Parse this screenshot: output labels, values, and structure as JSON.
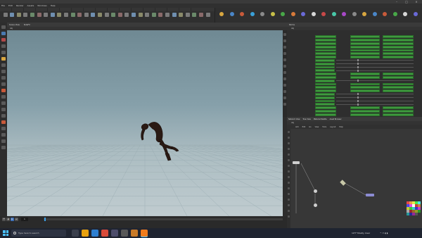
{
  "titlebar": {
    "text": ""
  },
  "menubar": {
    "items": [
      "File",
      "Edit",
      "Render",
      "Assets",
      "Windows",
      "Help"
    ]
  },
  "viewport": {
    "tabs": [
      "Scene View",
      "SideFX"
    ],
    "path": "obj"
  },
  "params": {
    "tabs": [
      "Parms"
    ],
    "path": "obj",
    "node_title": "",
    "rows": [
      {
        "label": "",
        "value": ""
      },
      {
        "label": "",
        "value": ""
      },
      {
        "label": "",
        "value": ""
      }
    ]
  },
  "network": {
    "tabs": [
      "Network View",
      "Tree View",
      "Material Palette",
      "Asset Browser"
    ],
    "path": "obj",
    "menu": [
      "Add",
      "Edit",
      "Go",
      "View",
      "Tools",
      "Layout",
      "Help"
    ],
    "nodes": [],
    "status": [
      "",
      ""
    ]
  },
  "playbar": {
    "frame": "1"
  },
  "taskbar": {
    "search_placeholder": "Type here to search",
    "weather": "19°F  Mostly clear",
    "time": "",
    "date": ""
  }
}
